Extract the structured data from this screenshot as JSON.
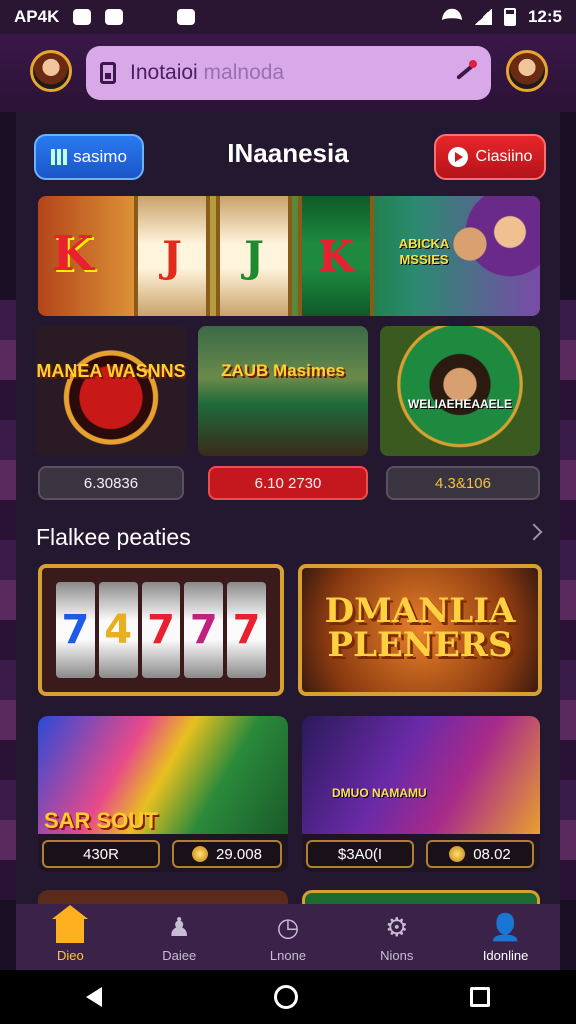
{
  "status_bar": {
    "carrier": "AP4K",
    "time": "12:5"
  },
  "search": {
    "text_main": "Inotaioi",
    "text_faded": " malnoda"
  },
  "title_row": {
    "left_pill": "sasimo",
    "title": "INaanesia",
    "right_pill": "Ciasiino"
  },
  "banner": {
    "letters": [
      "K",
      "J",
      "J",
      "K"
    ],
    "side_text": "ABICKA MSSIES"
  },
  "tiles": [
    {
      "label": "MANEA WASNNS"
    },
    {
      "label": "ZAUB Masimes"
    },
    {
      "label": "WELIAEHEAAELE"
    }
  ],
  "prices": [
    "6.30836",
    "6.10 2730",
    "4.3&106"
  ],
  "section": {
    "heading": "Flalkee peaties"
  },
  "big_cards": {
    "slot_numbers": [
      "7",
      "4",
      "7",
      "7",
      "7"
    ],
    "promo_title": "DMANLIA PLENERS"
  },
  "promos": [
    {
      "title": "SAR SOUT",
      "left_value": "430R",
      "right_value": "29.008"
    },
    {
      "title": "DMUO NAMAMU",
      "left_value": "$3A0(I",
      "right_value": "08.02"
    }
  ],
  "bottom_nav": [
    {
      "label": "Dieo",
      "icon": "home-icon"
    },
    {
      "label": "Daiee",
      "icon": "games-icon"
    },
    {
      "label": "Lnone",
      "icon": "clock-icon"
    },
    {
      "label": "Nions",
      "icon": "settings-icon"
    },
    {
      "label": "Idonline",
      "icon": "profile-icon"
    }
  ],
  "colors": {
    "accent": "#ffc830",
    "primary_bg": "#241830",
    "header_bg": "#3a1848",
    "search_bg": "#d9a8e8"
  }
}
